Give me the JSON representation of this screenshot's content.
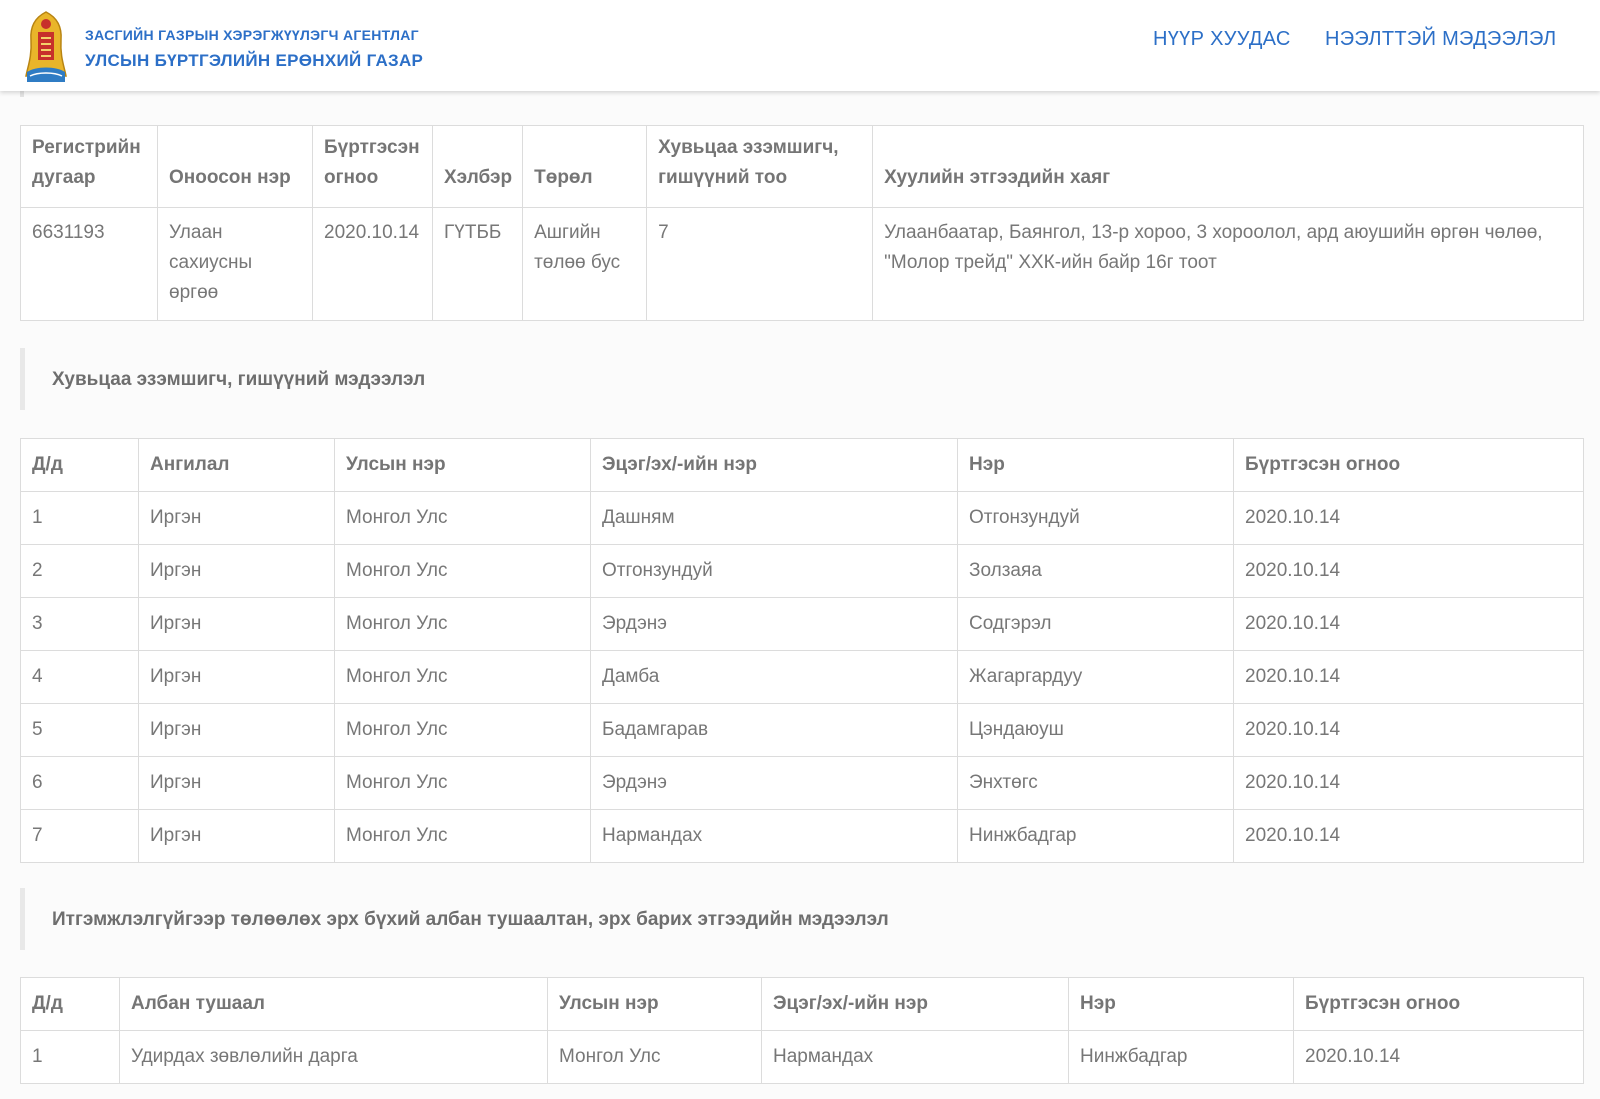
{
  "header": {
    "agency_line1": "ЗАСГИЙН ГАЗРЫН ХЭРЭГЖҮҮЛЭГЧ АГЕНТЛАГ",
    "agency_line2": "УЛСЫН БҮРТГЭЛИЙН ЕРӨНХИЙ ГАЗАР",
    "nav_home": "НҮҮР ХУУДАС",
    "nav_info": "НЭЭЛТТЭЙ МЭДЭЭЛЭЛ",
    "logo_icon": "soyombo-emblem-icon"
  },
  "entity": {
    "headers": {
      "reg": "Регистрийн дугаар",
      "name": "Оноосон нэр",
      "date": "Бүртгэсэн огноо",
      "form": "Хэлбэр",
      "type": "Төрөл",
      "holders": "Хувьцаа эзэмшигч, гишүүний тоо",
      "address": "Хуулийн этгээдийн хаяг"
    },
    "row": {
      "reg": "6631193",
      "name": "Улаан сахиусны өргөө",
      "date": "2020.10.14",
      "form": "ГҮТББ",
      "type": "Ашгийн төлөө бус",
      "holders": "7",
      "address": "Улаанбаатар, Баянгол, 13-р хороо, 3 хороолол, ард аюушийн өргөн чөлөө, \"Молор трейд\" ХХК-ийн байр 16г тоот"
    }
  },
  "members": {
    "title": "Хувьцаа эзэмшигч, гишүүний мэдээлэл",
    "headers": [
      "Д/д",
      "Ангилал",
      "Улсын нэр",
      "Эцэг/эх/-ийн нэр",
      "Нэр",
      "Бүртгэсэн огноо"
    ],
    "rows": [
      [
        "1",
        "Иргэн",
        "Монгол Улс",
        "Дашням",
        "Отгонзундуй",
        "2020.10.14"
      ],
      [
        "2",
        "Иргэн",
        "Монгол Улс",
        "Отгонзундуй",
        "Золзаяа",
        "2020.10.14"
      ],
      [
        "3",
        "Иргэн",
        "Монгол Улс",
        "Эрдэнэ",
        "Содгэрэл",
        "2020.10.14"
      ],
      [
        "4",
        "Иргэн",
        "Монгол Улс",
        "Дамба",
        "Жагаргардуу",
        "2020.10.14"
      ],
      [
        "5",
        "Иргэн",
        "Монгол Улс",
        "Бадамгарав",
        "Цэндаюуш",
        "2020.10.14"
      ],
      [
        "6",
        "Иргэн",
        "Монгол Улс",
        "Эрдэнэ",
        "Энхтөгс",
        "2020.10.14"
      ],
      [
        "7",
        "Иргэн",
        "Монгол Улс",
        "Нармандах",
        "Нинжбадгар",
        "2020.10.14"
      ]
    ]
  },
  "officials": {
    "title": "Итгэмжлэлгүйгээр төлөөлөх эрх бүхий албан тушаалтан, эрх барих этгээдийн мэдээлэл",
    "headers": [
      "Д/д",
      "Албан тушаал",
      "Улсын нэр",
      "Эцэг/эх/-ийн нэр",
      "Нэр",
      "Бүртгэсэн огноо"
    ],
    "rows": [
      [
        "1",
        "Удирдах зөвлөлийн дарга",
        "Монгол Улс",
        "Нармандах",
        "Нинжбадгар",
        "2020.10.14"
      ]
    ]
  }
}
